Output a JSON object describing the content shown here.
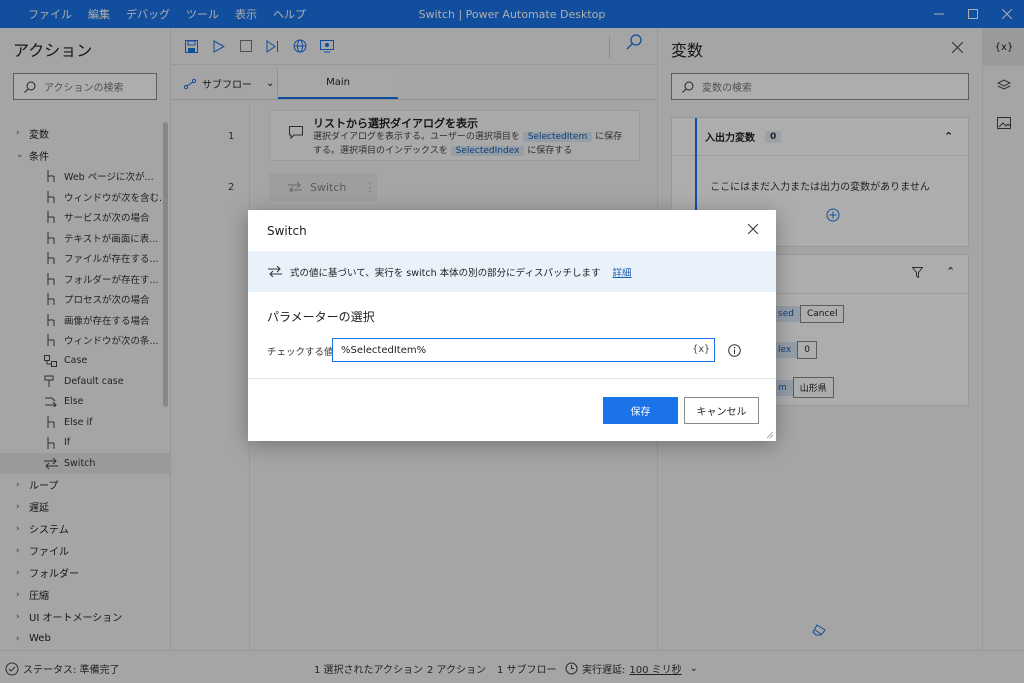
{
  "titlebar": {
    "menu": [
      "ファイル",
      "編集",
      "デバッグ",
      "ツール",
      "表示",
      "ヘルプ"
    ],
    "title": "Switch | Power Automate Desktop"
  },
  "actions_panel": {
    "heading": "アクション",
    "search_placeholder": "アクションの検索",
    "groups": [
      {
        "label": "変数",
        "expanded": false
      },
      {
        "label": "条件",
        "expanded": true
      }
    ],
    "condition_items": [
      "Web ページに次が...",
      "ウィンドウが次を含む...",
      "サービスが次の場合",
      "テキストが画面に表...",
      "ファイルが存在する...",
      "フォルダーが存在す...",
      "プロセスが次の場合",
      "画像が存在する場合",
      "ウィンドウが次の条...",
      "Case",
      "Default case",
      "Else",
      "Else if",
      "If",
      "Switch"
    ],
    "selected_item": "Switch",
    "more_groups": [
      "ループ",
      "遅延",
      "システム",
      "ファイル",
      "フォルダー",
      "圧縮",
      "UI オートメーション",
      "Web"
    ]
  },
  "editor": {
    "subflow_label": "サブフロー",
    "main_tab": "Main",
    "line_numbers": [
      "1",
      "2"
    ],
    "step1": {
      "title": "リストから選択ダイアログを表示",
      "desc_a": "選択ダイアログを表示する。ユーザーの選択項目を",
      "chip_a": "SelectedItem",
      "desc_b": "に保存する。選択項目のインデックスを",
      "chip_b": "SelectedIndex",
      "desc_c": "に保存する"
    },
    "step2_label": "Switch"
  },
  "variables_panel": {
    "heading": "変数",
    "search_placeholder": "変数の検索",
    "io_header": "入出力変数",
    "io_count": "0",
    "io_empty": "ここにはまだ入力または出力の変数がありません",
    "rows": [
      {
        "chip": "sed",
        "value": "Cancel"
      },
      {
        "chip": "lex",
        "value": "0"
      },
      {
        "chip": "m",
        "value": "山形県"
      }
    ]
  },
  "rail": {
    "vars_label": "{x}"
  },
  "status": {
    "status_text": "ステータス: 準備完了",
    "selected_actions": "1 選択されたアクション",
    "actions": "2 アクション",
    "subflows": "1 サブフロー",
    "delay_label": "実行遅延:",
    "delay_value": "100 ミリ秒"
  },
  "dialog": {
    "title": "Switch",
    "info_text": "式の値に基づいて、実行を switch 本体の別の部分にディスパッチします",
    "info_link": "詳細",
    "section_title": "パラメーターの選択",
    "field_label": "チェックする値:",
    "field_value": "%SelectedItem%",
    "var_button": "{x}",
    "save_label": "保存",
    "cancel_label": "キャンセル"
  },
  "colors": {
    "accent": "#1a73e8",
    "chip_bg": "#dce8f7"
  }
}
